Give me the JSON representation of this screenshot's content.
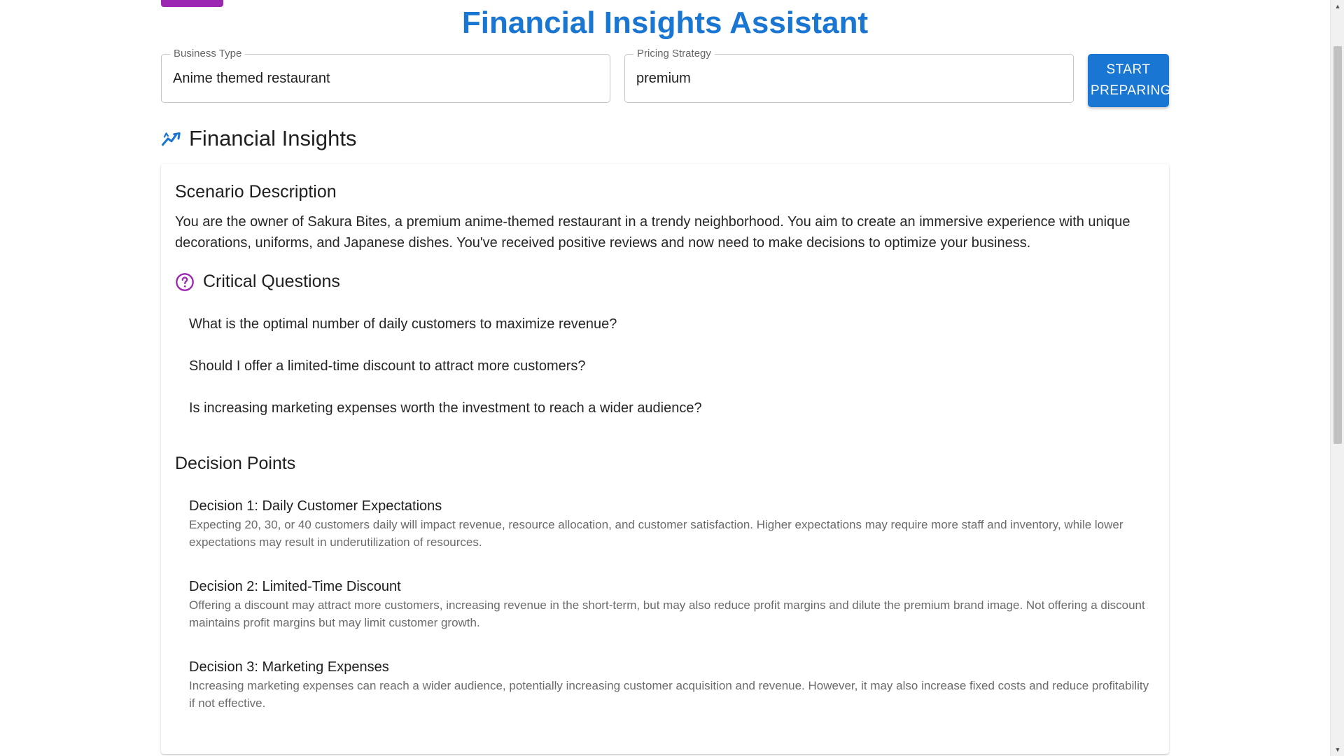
{
  "app": {
    "title": "Financial Insights Assistant"
  },
  "form": {
    "business_type": {
      "label": "Business Type",
      "value": "Anime themed restaurant"
    },
    "pricing_strategy": {
      "label": "Pricing Strategy",
      "value": "premium"
    },
    "start_button_label": "Start Preparing"
  },
  "insights": {
    "section_title": "Financial Insights",
    "icon": "trending-up-icon",
    "accent_color": "#1976d2",
    "scenario": {
      "heading": "Scenario Description",
      "text": "You are the owner of Sakura Bites, a premium anime-themed restaurant in a trendy neighborhood. You aim to create an immersive experience with unique decorations, uniforms, and Japanese dishes. You've received positive reviews and now need to make decisions to optimize your business."
    },
    "critical_questions": {
      "heading": "Critical Questions",
      "icon": "help-circle-icon",
      "icon_color": "#9c27b0",
      "items": [
        "What is the optimal number of daily customers to maximize revenue?",
        "Should I offer a limited-time discount to attract more customers?",
        "Is increasing marketing expenses worth the investment to reach a wider audience?"
      ]
    },
    "decision_points": {
      "heading": "Decision Points",
      "items": [
        {
          "title": "Decision 1: Daily Customer Expectations",
          "description": "Expecting 20, 30, or 40 customers daily will impact revenue, resource allocation, and customer satisfaction. Higher expectations may require more staff and inventory, while lower expectations may result in underutilization of resources."
        },
        {
          "title": "Decision 2: Limited-Time Discount",
          "description": "Offering a discount may attract more customers, increasing revenue in the short-term, but may also reduce profit margins and dilute the premium brand image. Not offering a discount maintains profit margins but may limit customer growth."
        },
        {
          "title": "Decision 3: Marketing Expenses",
          "description": "Increasing marketing expenses can reach a wider audience, potentially increasing customer acquisition and revenue. However, it may also increase fixed costs and reduce profitability if not effective."
        }
      ]
    }
  },
  "colors": {
    "primary": "#1976d2",
    "secondary": "#9c27b0"
  }
}
